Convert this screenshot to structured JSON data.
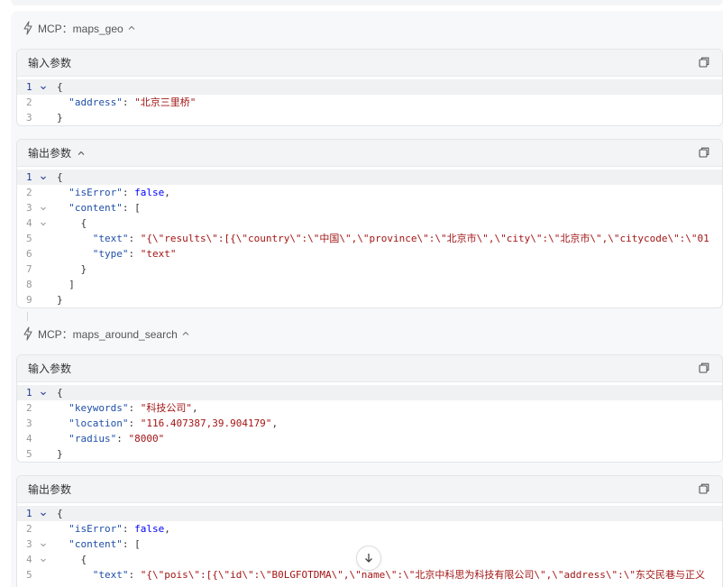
{
  "tools": [
    {
      "label": "MCP：maps_geo",
      "input": {
        "title": "输入参数",
        "lines": [
          {
            "n": "1",
            "fold": true,
            "parts": [
              [
                "p",
                "{"
              ]
            ]
          },
          {
            "n": "2",
            "fold": false,
            "parts": [
              [
                "p",
                "  "
              ],
              [
                "k",
                "\"address\""
              ],
              [
                "p",
                ": "
              ],
              [
                "s",
                "\"北京三里桥\""
              ]
            ]
          },
          {
            "n": "3",
            "fold": false,
            "parts": [
              [
                "p",
                "}"
              ]
            ]
          }
        ]
      },
      "output": {
        "title": "输出参数",
        "lines": [
          {
            "n": "1",
            "fold": true,
            "parts": [
              [
                "p",
                "{"
              ]
            ]
          },
          {
            "n": "2",
            "fold": false,
            "parts": [
              [
                "p",
                "  "
              ],
              [
                "k",
                "\"isError\""
              ],
              [
                "p",
                ": "
              ],
              [
                "b",
                "false"
              ],
              [
                "p",
                ","
              ]
            ]
          },
          {
            "n": "3",
            "fold": true,
            "parts": [
              [
                "p",
                "  "
              ],
              [
                "k",
                "\"content\""
              ],
              [
                "p",
                ": ["
              ]
            ]
          },
          {
            "n": "4",
            "fold": true,
            "parts": [
              [
                "p",
                "    {"
              ]
            ]
          },
          {
            "n": "5",
            "fold": false,
            "parts": [
              [
                "p",
                "      "
              ],
              [
                "k",
                "\"text\""
              ],
              [
                "p",
                ": "
              ],
              [
                "s",
                "\"{\\\"results\\\":[{\\\"country\\\":\\\"中国\\\",\\\"province\\\":\\\"北京市\\\",\\\"city\\\":\\\"北京市\\\",\\\"citycode\\\":\\\"01"
              ]
            ]
          },
          {
            "n": "6",
            "fold": false,
            "parts": [
              [
                "p",
                "      "
              ],
              [
                "k",
                "\"type\""
              ],
              [
                "p",
                ": "
              ],
              [
                "s",
                "\"text\""
              ]
            ]
          },
          {
            "n": "7",
            "fold": false,
            "parts": [
              [
                "p",
                "    }"
              ]
            ]
          },
          {
            "n": "8",
            "fold": false,
            "parts": [
              [
                "p",
                "  ]"
              ]
            ]
          },
          {
            "n": "9",
            "fold": false,
            "parts": [
              [
                "p",
                "}"
              ]
            ]
          }
        ]
      }
    },
    {
      "label": "MCP：maps_around_search",
      "input": {
        "title": "输入参数",
        "lines": [
          {
            "n": "1",
            "fold": true,
            "parts": [
              [
                "p",
                "{"
              ]
            ]
          },
          {
            "n": "2",
            "fold": false,
            "parts": [
              [
                "p",
                "  "
              ],
              [
                "k",
                "\"keywords\""
              ],
              [
                "p",
                ": "
              ],
              [
                "s",
                "\"科技公司\""
              ],
              [
                "p",
                ","
              ]
            ]
          },
          {
            "n": "3",
            "fold": false,
            "parts": [
              [
                "p",
                "  "
              ],
              [
                "k",
                "\"location\""
              ],
              [
                "p",
                ": "
              ],
              [
                "s",
                "\"116.407387,39.904179\""
              ],
              [
                "p",
                ","
              ]
            ]
          },
          {
            "n": "4",
            "fold": false,
            "parts": [
              [
                "p",
                "  "
              ],
              [
                "k",
                "\"radius\""
              ],
              [
                "p",
                ": "
              ],
              [
                "s",
                "\"8000\""
              ]
            ]
          },
          {
            "n": "5",
            "fold": false,
            "parts": [
              [
                "p",
                "}"
              ]
            ]
          }
        ]
      },
      "output": {
        "title": "输出参数",
        "lines": [
          {
            "n": "1",
            "fold": true,
            "parts": [
              [
                "p",
                "{"
              ]
            ]
          },
          {
            "n": "2",
            "fold": false,
            "parts": [
              [
                "p",
                "  "
              ],
              [
                "k",
                "\"isError\""
              ],
              [
                "p",
                ": "
              ],
              [
                "b",
                "false"
              ],
              [
                "p",
                ","
              ]
            ]
          },
          {
            "n": "3",
            "fold": true,
            "parts": [
              [
                "p",
                "  "
              ],
              [
                "k",
                "\"content\""
              ],
              [
                "p",
                ": ["
              ]
            ]
          },
          {
            "n": "4",
            "fold": true,
            "parts": [
              [
                "p",
                "    {"
              ]
            ]
          },
          {
            "n": "5",
            "fold": false,
            "parts": [
              [
                "p",
                "      "
              ],
              [
                "k",
                "\"text\""
              ],
              [
                "p",
                ": "
              ],
              [
                "s",
                "\"{\\\"pois\\\":[{\\\"id\\\":\\\"B0LGFOTDMA\\\",\\\"name\\\":\\\"北京中科思为科技有限公司\\\",\\\"address\\\":\\\"东交民巷与正义"
              ]
            ]
          }
        ]
      }
    }
  ],
  "icons": {
    "tool": "lightning-icon",
    "copy": "copy-icon",
    "collapse": "chevron-up-icon",
    "fold": "chevron-down-icon",
    "scroll": "arrow-down-icon"
  },
  "colors": {
    "key": "#1f4fa8",
    "string": "#a31515",
    "boolean": "#0000ff",
    "panel_bg": "#f7f8fa",
    "header_bg": "#f3f4f6"
  }
}
